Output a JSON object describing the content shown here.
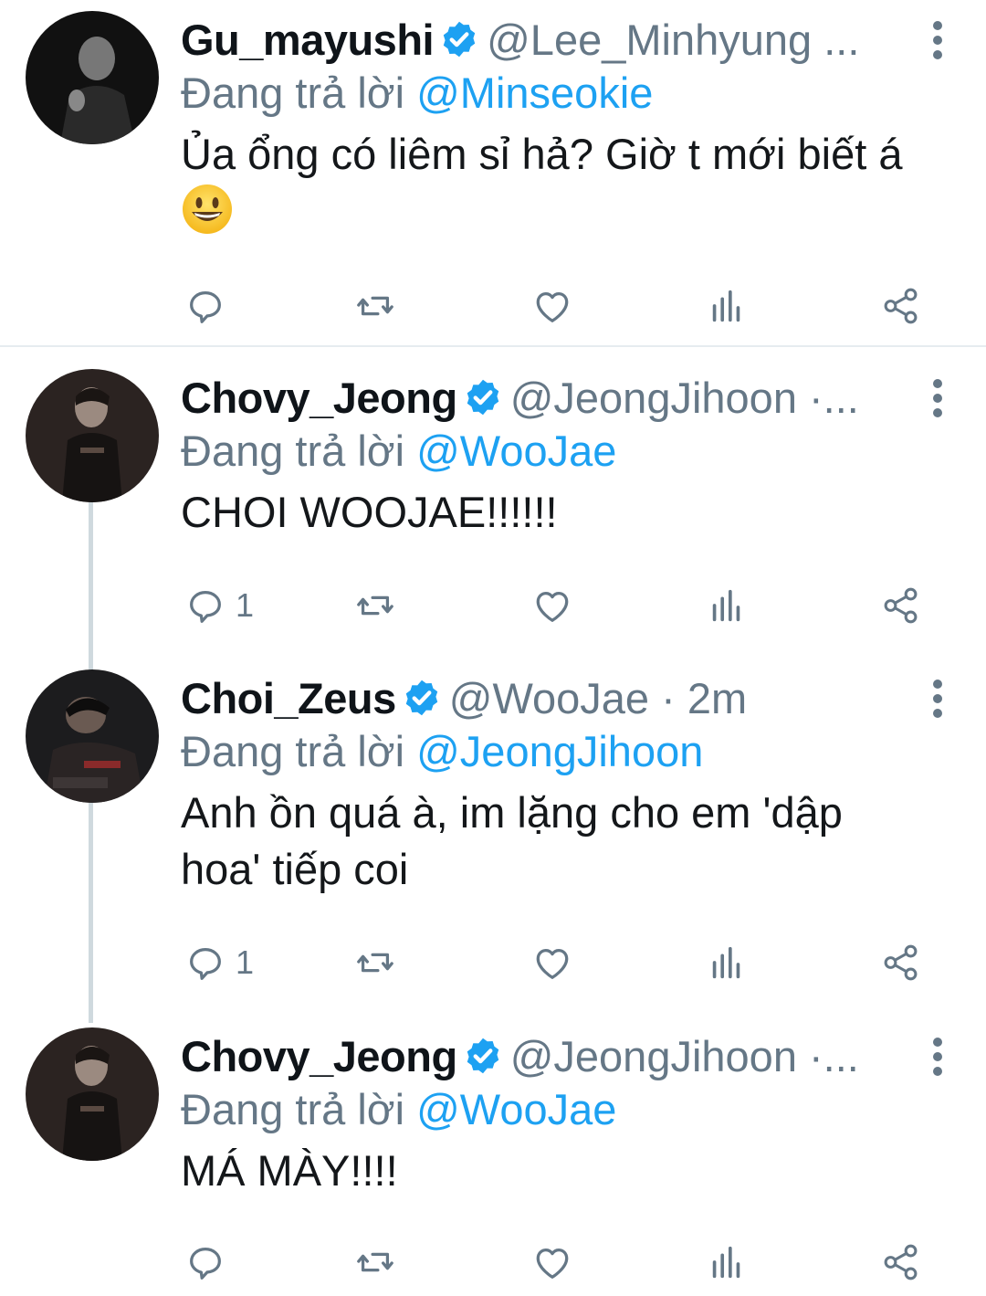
{
  "tweets": [
    {
      "display_name": "Gu_mayushi",
      "handle": "@Lee_Minhyung ...",
      "reply_prefix": "Đang trả lời",
      "reply_to": "@Minseokie",
      "text": "Ủa ổng có liêm sỉ hả? Giờ t mới biết á",
      "emoji": "grinning-face",
      "reply_count": "",
      "verified": true
    },
    {
      "display_name": "Chovy_Jeong",
      "handle": "@JeongJihoon ·...",
      "reply_prefix": "Đang trả lời",
      "reply_to": "@WooJae",
      "text": "CHOI WOOJAE!!!!!!",
      "reply_count": "1",
      "verified": true
    },
    {
      "display_name": "Choi_Zeus",
      "handle": "@WooJae · 2m",
      "reply_prefix": "Đang trả lời",
      "reply_to": "@JeongJihoon",
      "text": "Anh ồn quá à, im lặng cho em 'dập hoa' tiếp coi",
      "reply_count": "1",
      "verified": true
    },
    {
      "display_name": "Chovy_Jeong",
      "handle": "@JeongJihoon ·...",
      "reply_prefix": "Đang trả lời",
      "reply_to": "@WooJae",
      "text": "MÁ MÀY!!!!",
      "reply_count": "",
      "verified": true
    }
  ],
  "colors": {
    "accent": "#1da1f2",
    "secondary_text": "#657786",
    "thread_line": "#cfd9de",
    "divider": "#e6ecf0"
  },
  "icons": [
    "verified-badge-icon",
    "more-options-icon",
    "reply-icon",
    "retweet-icon",
    "like-icon",
    "analytics-icon",
    "share-icon"
  ]
}
